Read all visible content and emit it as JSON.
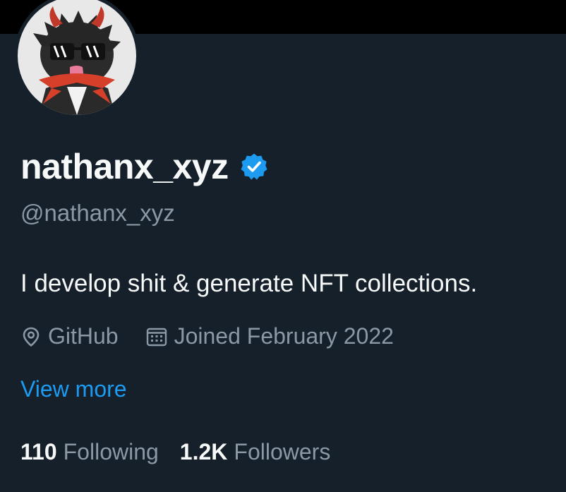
{
  "profile": {
    "display_name": "nathanx_xyz",
    "handle": "@nathanx_xyz",
    "bio": "I develop shit & generate NFT collections.",
    "verified_icon": "verified-badge-icon",
    "location_icon": "location-pin-icon",
    "location": "GitHub",
    "joined_icon": "calendar-icon",
    "joined": "Joined February 2022",
    "view_more": "View more"
  },
  "stats": {
    "following_count": "110",
    "following_label": "Following",
    "followers_count": "1.2K",
    "followers_label": "Followers"
  },
  "colors": {
    "background": "#15202b",
    "banner": "#000000",
    "accent": "#1d9bf0",
    "secondary_text": "#8b98a5",
    "primary_text": "#f7f9f9"
  }
}
